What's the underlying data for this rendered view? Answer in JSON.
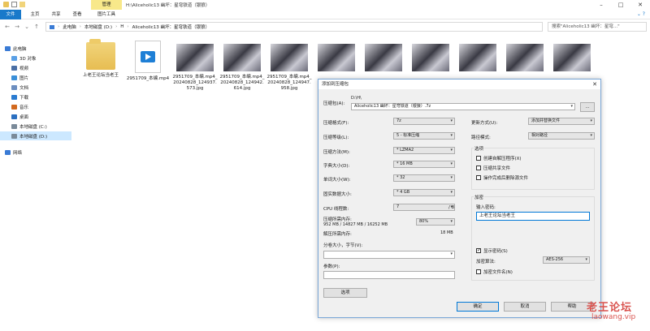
{
  "window": {
    "title": "H:\\Aliceholic13 幽坏：星穹铁道（银狼）",
    "context_tab": "管理"
  },
  "ribbon": {
    "tabs": [
      "文件",
      "主页",
      "共享",
      "查看",
      "图片工具"
    ]
  },
  "address": {
    "crumbs": [
      "此电脑",
      "本地磁盘 (D:)",
      "H",
      "Aliceholic13 幽坏：星穹铁道（银狼）"
    ],
    "search_placeholder": "搜索\"Aliceholic13 幽坏：星穹...\""
  },
  "nav": {
    "items": [
      {
        "label": "此电脑",
        "color": "#3a7bd5"
      },
      {
        "label": "3D 对象",
        "color": "#5aa0e6"
      },
      {
        "label": "视频",
        "color": "#4a6fa5"
      },
      {
        "label": "图片",
        "color": "#3a8fd8"
      },
      {
        "label": "文档",
        "color": "#6c8ebf"
      },
      {
        "label": "下载",
        "color": "#2a7bd0"
      },
      {
        "label": "音乐",
        "color": "#d2691e"
      },
      {
        "label": "桌面",
        "color": "#2a6fc0"
      },
      {
        "label": "本地磁盘 (C:)",
        "color": "#7a8a99"
      },
      {
        "label": "本地磁盘 (D:)",
        "color": "#7a8a99"
      },
      {
        "label": "网络",
        "color": "#3a7bd5"
      }
    ]
  },
  "files": [
    {
      "type": "folder",
      "label": "上老王论坛当老王"
    },
    {
      "type": "mp4",
      "label": "2951709_本编.mp4"
    },
    {
      "type": "photo",
      "label": "2951709_本编.mp4_20240828_124937.573.jpg"
    },
    {
      "type": "photo",
      "label": "2951709_本编.mp4_20240828_124942.614.jpg"
    },
    {
      "type": "photo",
      "label": "2951709_本编.mp4_20240828_124947.958.jpg"
    },
    {
      "type": "photo",
      "label": ""
    },
    {
      "type": "photo",
      "label": ""
    },
    {
      "type": "photo",
      "label": ""
    },
    {
      "type": "photo",
      "label": ""
    },
    {
      "type": "photo",
      "label": ""
    },
    {
      "type": "photo",
      "label": ""
    }
  ],
  "dialog": {
    "title": "添加到压缩包",
    "archive_label": "压缩包(A):",
    "archive_dir": "D:\\H\\",
    "archive_name": "Aliceholic13 幽坏：星穹铁道（银狼）.7z",
    "browse_button": "...",
    "format_label": "压缩格式(F):",
    "format_value": "7z",
    "level_label": "压缩等级(L):",
    "level_value": "5 - 标准压缩",
    "method_label": "压缩方法(M):",
    "method_value": "* LZMA2",
    "dict_label": "字典大小(D):",
    "dict_value": "* 16 MB",
    "word_label": "单词大小(W):",
    "word_value": "* 32",
    "solid_label": "固实数据大小:",
    "solid_value": "* 4 GB",
    "threads_label": "CPU 线程数:",
    "threads_value": "7",
    "threads_total": "/ 8",
    "mem_compress_label": "压缩所需内存:",
    "mem_compress_value": "952 MB / 14827 MB / 16252 MB",
    "mem_percent": "80%",
    "mem_decompress_label": "解压所需内存:",
    "mem_decompress_value": "18 MB",
    "split_label": "分卷大小，字节(V):",
    "params_label": "参数(P):",
    "options_button": "选项",
    "update_label": "更新方式(U):",
    "update_value": "添加并替换文件",
    "path_label": "路径模式:",
    "path_value": "相对路径",
    "options_group": "选项",
    "opt_sfx": "创建自解压程序(X)",
    "opt_shared": "压缩共享文件",
    "opt_delete": "操作完成后删除源文件",
    "encrypt_group": "加密",
    "password_label": "输入密码:",
    "password_value": "上老王论坛当老王",
    "show_password": "显示密码(S)",
    "enc_method_label": "加密算法:",
    "enc_method_value": "AES-256",
    "encrypt_names": "加密文件名(N)",
    "ok": "确定",
    "cancel": "取消",
    "help": "帮助"
  },
  "watermark": {
    "line1": "老王论坛",
    "line2": "laowang.vip"
  }
}
